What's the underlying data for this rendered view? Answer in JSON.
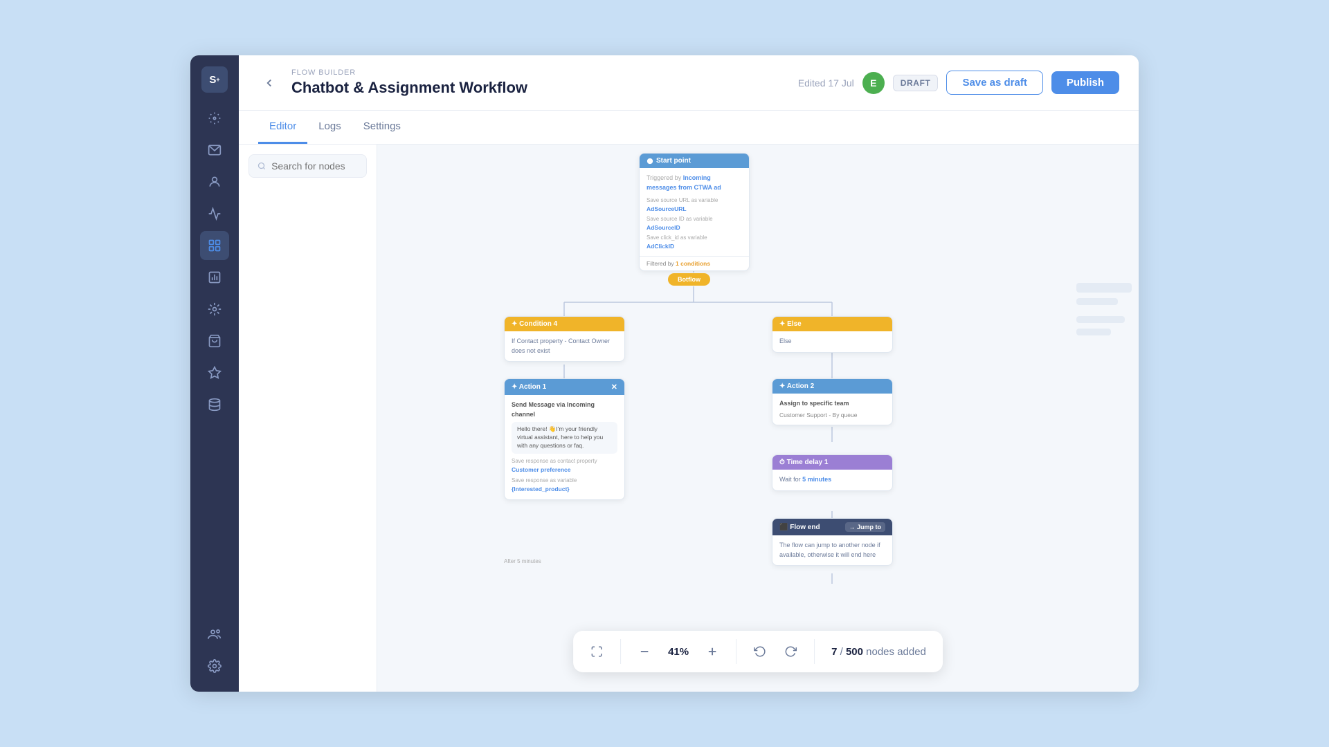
{
  "app": {
    "logo": "S",
    "logo_sup": "+"
  },
  "sidebar": {
    "icons": [
      {
        "name": "broadcast-icon",
        "symbol": "📡",
        "active": false
      },
      {
        "name": "inbox-icon",
        "symbol": "✉",
        "active": false
      },
      {
        "name": "contacts-icon",
        "symbol": "👤",
        "active": false
      },
      {
        "name": "campaigns-icon",
        "symbol": "📣",
        "active": false
      },
      {
        "name": "flow-builder-icon",
        "symbol": "⬡",
        "active": true
      },
      {
        "name": "reports-icon",
        "symbol": "📊",
        "active": false
      },
      {
        "name": "integrations-icon",
        "symbol": "🔧",
        "active": false
      },
      {
        "name": "store-icon",
        "symbol": "🛒",
        "active": false
      },
      {
        "name": "ai-icon",
        "symbol": "✨",
        "active": false
      },
      {
        "name": "database-icon",
        "symbol": "🗃",
        "active": false
      }
    ],
    "bottom_icons": [
      {
        "name": "team-icon",
        "symbol": "👥"
      },
      {
        "name": "settings-icon",
        "symbol": "⚙"
      }
    ]
  },
  "header": {
    "breadcrumb": "FLOW BUILDER",
    "title": "Chatbot & Assignment Workflow",
    "edited_label": "Edited 17 Jul",
    "user_initial": "E",
    "draft_badge": "DRAFT",
    "save_draft_label": "Save as draft",
    "publish_label": "Publish"
  },
  "tabs": [
    {
      "label": "Editor",
      "active": true
    },
    {
      "label": "Logs",
      "active": false
    },
    {
      "label": "Settings",
      "active": false
    }
  ],
  "editor": {
    "search_placeholder": "Search for nodes"
  },
  "flow": {
    "start_node": {
      "title": "Start point",
      "trigger_prefix": "Triggered by",
      "trigger_text": "Incoming messages from CTWA ad",
      "save_label": "Save source URL as variable",
      "vars": [
        "AdSourceURL",
        "AdSourceID",
        "AdClickID"
      ],
      "filter_text": "Filtered by",
      "filter_badge": "1 conditions"
    },
    "decision_pill": "Botflow",
    "condition4": {
      "title": "✦ Condition 4",
      "body": "If Contact property - Contact Owner does not exist"
    },
    "else_node": {
      "title": "✦ Else",
      "body": "Else"
    },
    "action1": {
      "title": "✦ Action 1",
      "send_label": "Send Message via Incoming channel",
      "msg": "Hello there! 👋I'm your friendly virtual assistant, here to help you with any questions or faq.",
      "save_contact": "Save response as contact property",
      "property": "Customer preference",
      "save_var": "Save response as variable",
      "var_name": "{Interested_product}"
    },
    "action2": {
      "title": "✦ Action 2",
      "label": "Assign to specific team",
      "queue": "Customer Support - By queue"
    },
    "time_delay1": {
      "title": "⏱ Time delay 1",
      "label": "Wait for",
      "value": "5 minutes"
    },
    "flow_end": {
      "title": "⬛ Flow end",
      "jump_label": "→ Jump to",
      "body": "The flow can jump to another node if available, otherwise it will end here"
    }
  },
  "toolbar": {
    "zoom_value": "41%",
    "nodes_current": "7",
    "nodes_max": "500",
    "nodes_label": "nodes added"
  }
}
